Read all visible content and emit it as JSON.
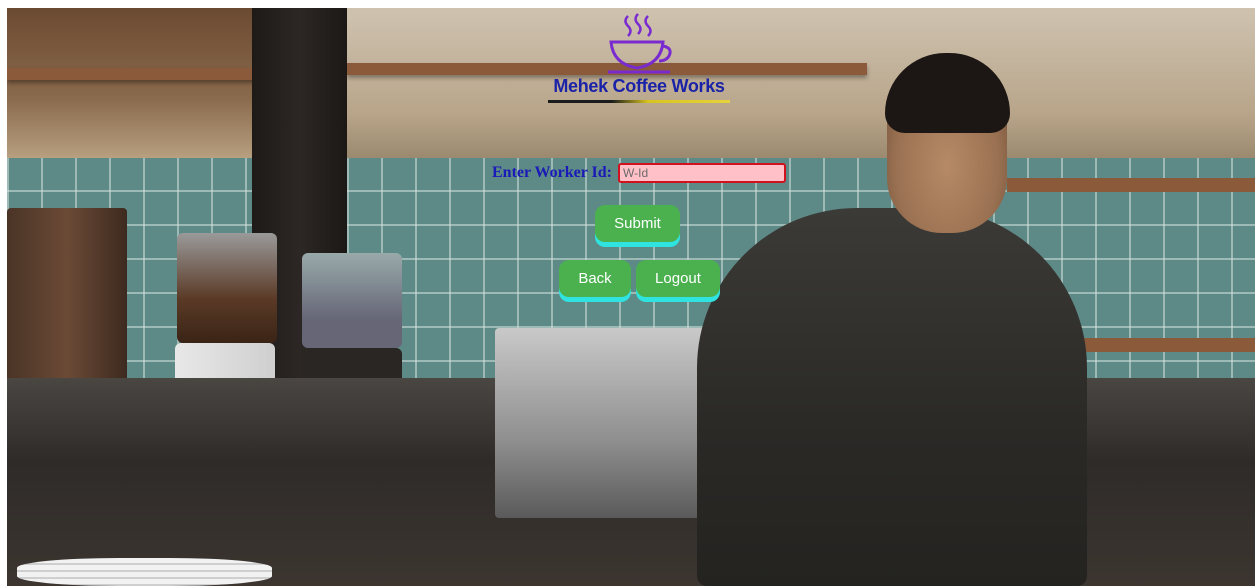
{
  "brand": {
    "name": "Mehek Coffee Works",
    "logo_icon": "coffee-cup-icon",
    "colors": {
      "brand_text": "#1a22a8",
      "cup_stroke": "#7a2bd0",
      "underline_dark": "#1c1c1c",
      "underline_gold": "#d8c420"
    }
  },
  "form": {
    "worker_label": "Enter Worker Id:",
    "worker_input": {
      "value": "",
      "placeholder": "W-Id"
    },
    "submit_label": "Submit"
  },
  "nav": {
    "back_label": "Back",
    "logout_label": "Logout"
  },
  "theme": {
    "button_bg": "#4bb14f",
    "button_shadow": "#2fe3e0",
    "input_border": "#d0121e",
    "input_bg": "#ffc0c8",
    "label_color": "#1a1ab8"
  }
}
